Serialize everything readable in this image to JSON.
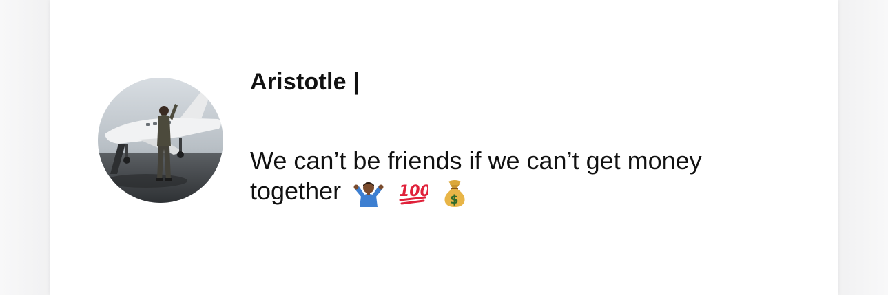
{
  "post": {
    "author_name": "Aristotle |",
    "message_line_1": "We can’t be friends if we can’t get money",
    "message_line_2": "together",
    "emojis": [
      "person-shrugging-emoji",
      "hundred-points-emoji",
      "money-bag-emoji"
    ]
  },
  "colors": {
    "background": "#f6f6f7",
    "card": "#ffffff",
    "text": "#111111"
  }
}
